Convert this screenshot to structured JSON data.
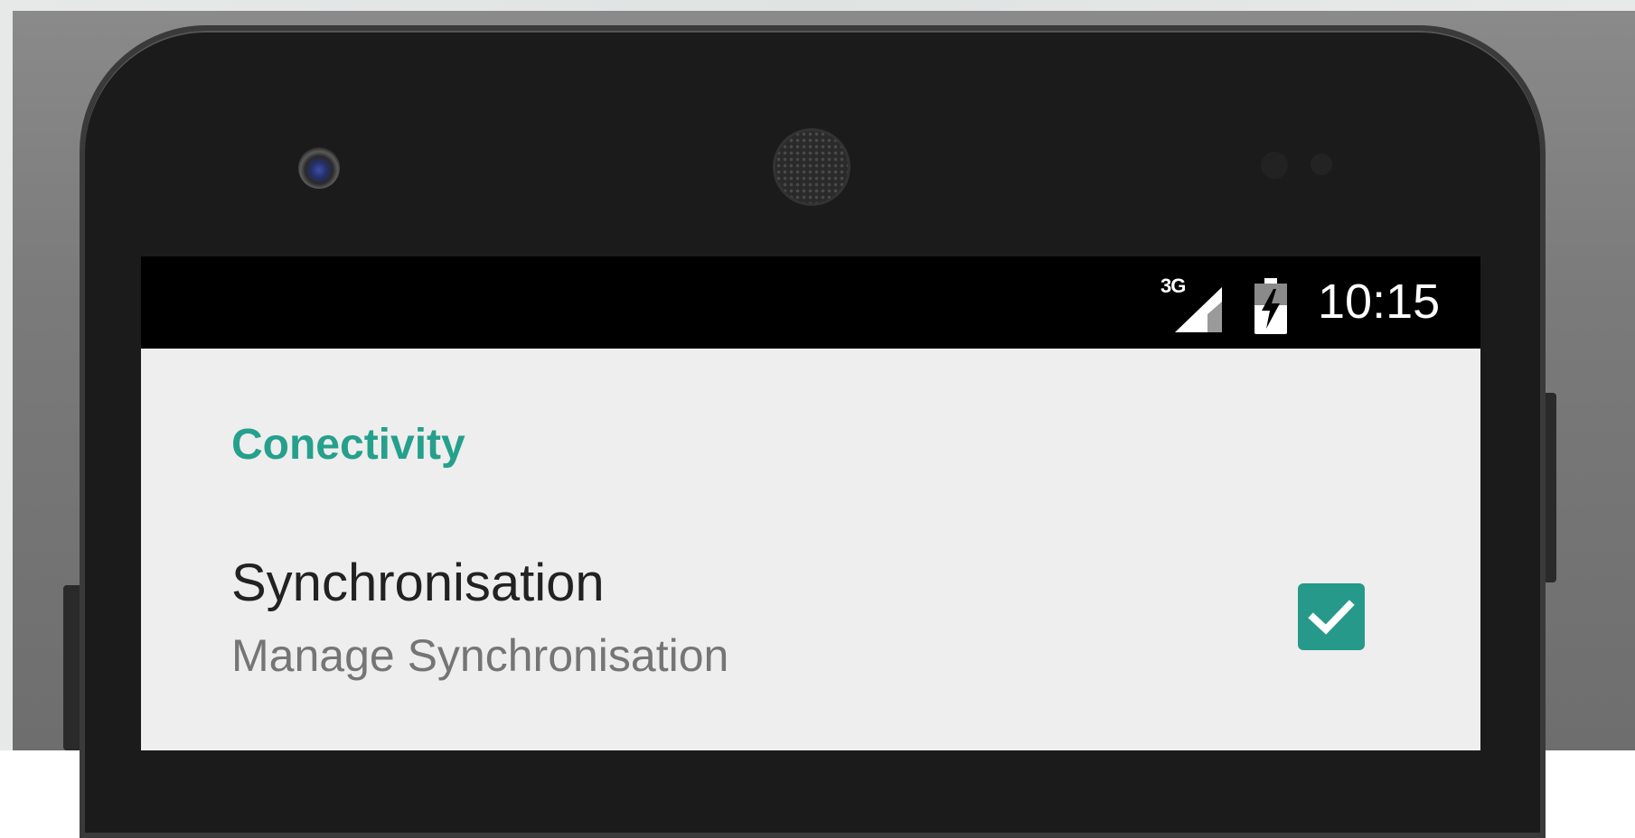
{
  "status_bar": {
    "network_type": "3G",
    "time": "10:15",
    "icons": [
      "cell-signal-icon",
      "battery-charging-icon"
    ]
  },
  "settings": {
    "category_title": "Conectivity",
    "items": [
      {
        "title": "Synchronisation",
        "summary": "Manage Synchronisation",
        "checked": true
      }
    ]
  },
  "colors": {
    "accent": "#26998a",
    "category_text": "#25a08c",
    "screen_bg": "#eeeeee",
    "status_bar_bg": "#000000",
    "phone_body": "#1b1b1b"
  }
}
